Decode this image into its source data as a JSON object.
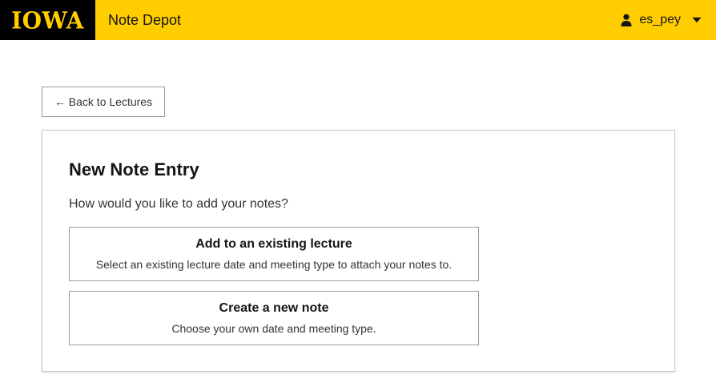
{
  "header": {
    "logo_text": "IOWA",
    "app_title": "Note Depot",
    "username": "es_pey",
    "user_icon": "person-icon",
    "menu_icon": "caret-down-icon",
    "brand_gold": "#FFCD00",
    "brand_black": "#000000"
  },
  "nav": {
    "back_label": "← Back to Lectures"
  },
  "card": {
    "title": "New Note Entry",
    "question": "How would you like to add your notes?",
    "options": [
      {
        "title": "Add to an existing lecture",
        "description": "Select an existing lecture date and meeting type to attach your notes to."
      },
      {
        "title": "Create a new note",
        "description": "Choose your own date and meeting type."
      }
    ]
  }
}
